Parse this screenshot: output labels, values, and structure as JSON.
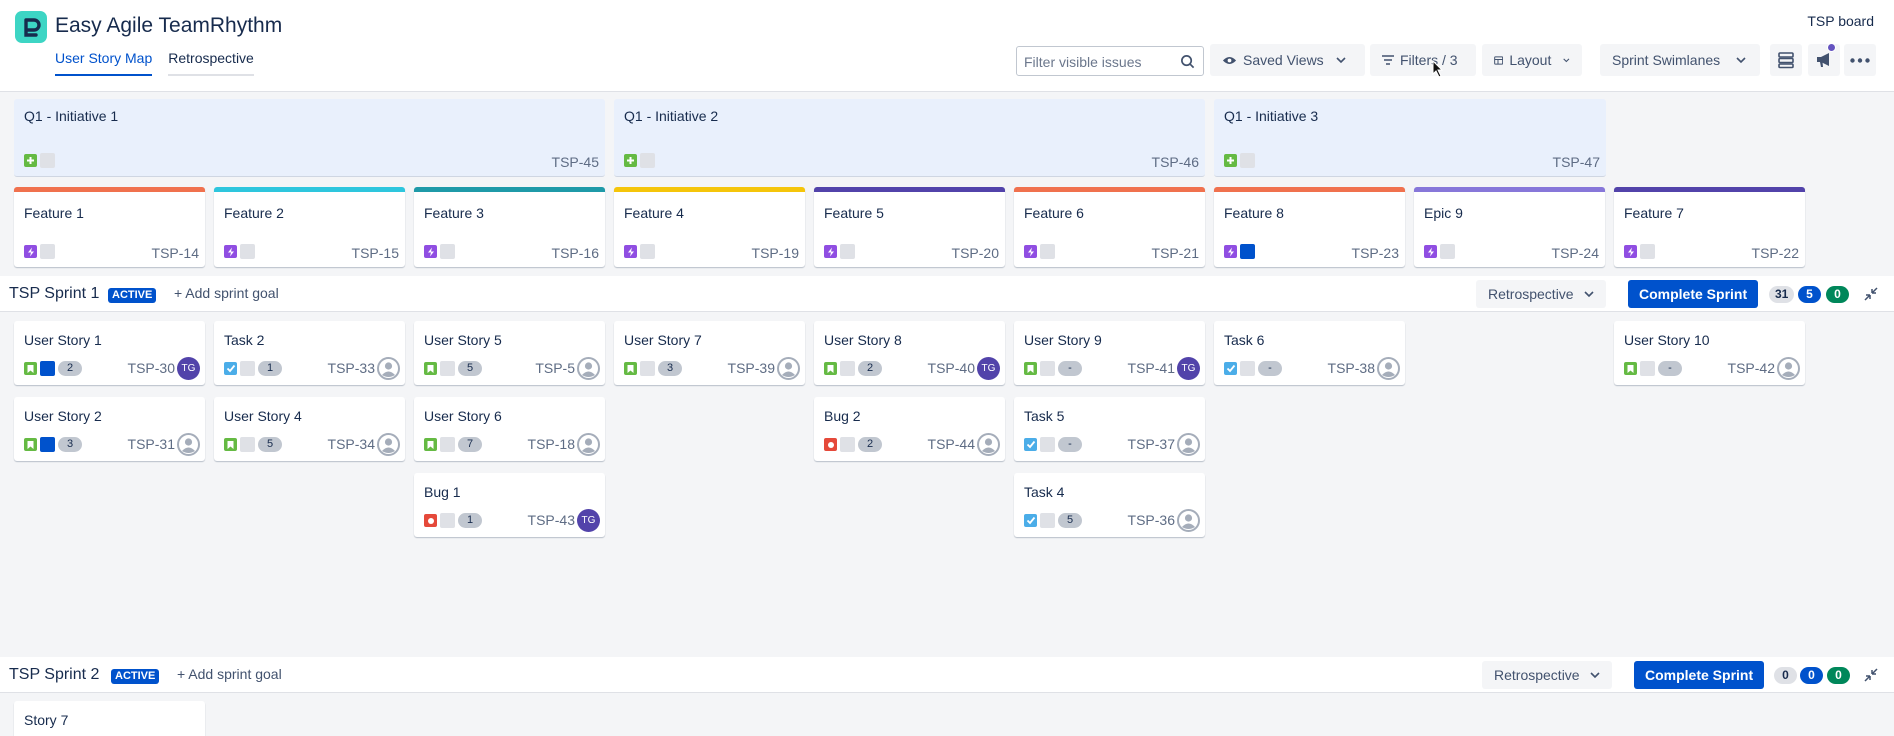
{
  "app": {
    "title": "Easy Agile TeamRhythm",
    "board_name": "TSP board"
  },
  "tabs": [
    {
      "label": "User Story Map"
    },
    {
      "label": "Retrospective"
    }
  ],
  "toolbar": {
    "search_placeholder": "Filter visible issues",
    "saved_views": "Saved Views",
    "filters": "Filters / 3",
    "layout": "Layout",
    "swimlanes": "Sprint Swimlanes"
  },
  "colors": {
    "accent": "#0052cc",
    "initiative_bg": "#e9f0fc",
    "story_type": "#65ba43",
    "task_type": "#4bade8",
    "bug_type": "#e5493a",
    "epic_type": "#904ee2"
  },
  "initiatives": [
    {
      "title": "Q1 - Initiative 1",
      "key": "TSP-45"
    },
    {
      "title": "Q1 - Initiative 2",
      "key": "TSP-46"
    },
    {
      "title": "Q1 - Initiative 3",
      "key": "TSP-47"
    }
  ],
  "features": [
    {
      "title": "Feature 1",
      "key": "TSP-14",
      "color": "#f0714e"
    },
    {
      "title": "Feature 2",
      "key": "TSP-15",
      "color": "#2ec6dd"
    },
    {
      "title": "Feature 3",
      "key": "TSP-16",
      "color": "#1f9aa8"
    },
    {
      "title": "Feature 4",
      "key": "TSP-19",
      "color": "#f5c50a"
    },
    {
      "title": "Feature 5",
      "key": "TSP-20",
      "color": "#5243aa"
    },
    {
      "title": "Feature 6",
      "key": "TSP-21",
      "color": "#f0714e"
    },
    {
      "title": "Feature 8",
      "key": "TSP-23",
      "color": "#f0714e"
    },
    {
      "title": "Epic 9",
      "key": "TSP-24",
      "color": "#8777d9"
    },
    {
      "title": "Feature 7",
      "key": "TSP-22",
      "color": "#5243aa"
    }
  ],
  "sprints": [
    {
      "name": "TSP Sprint 1",
      "status": "ACTIVE",
      "add_goal": "Add sprint goal",
      "retro": "Retrospective",
      "complete": "Complete Sprint",
      "counts": [
        "31",
        "5",
        "0"
      ]
    },
    {
      "name": "TSP Sprint 2",
      "status": "ACTIVE",
      "add_goal": "Add sprint goal",
      "retro": "Retrospective",
      "complete": "Complete Sprint",
      "counts": [
        "0",
        "0",
        "0"
      ]
    }
  ],
  "sprint1_cards": [
    {
      "title": "User Story 1",
      "key": "TSP-30",
      "points": "2",
      "assignee": "TG"
    },
    {
      "title": "User Story 2",
      "key": "TSP-31",
      "points": "3",
      "assignee": ""
    },
    {
      "title": "Task 2",
      "key": "TSP-33",
      "points": "1",
      "assignee": ""
    },
    {
      "title": "User Story 4",
      "key": "TSP-34",
      "points": "5",
      "assignee": ""
    },
    {
      "title": "User Story 5",
      "key": "TSP-5",
      "points": "5",
      "assignee": ""
    },
    {
      "title": "User Story 6",
      "key": "TSP-18",
      "points": "7",
      "assignee": ""
    },
    {
      "title": "Bug 1",
      "key": "TSP-43",
      "points": "1",
      "assignee": "TG"
    },
    {
      "title": "User Story 7",
      "key": "TSP-39",
      "points": "3",
      "assignee": ""
    },
    {
      "title": "User Story 8",
      "key": "TSP-40",
      "points": "2",
      "assignee": "TG"
    },
    {
      "title": "Bug 2",
      "key": "TSP-44",
      "points": "2",
      "assignee": ""
    },
    {
      "title": "User Story 9",
      "key": "TSP-41",
      "points": "-",
      "assignee": "TG"
    },
    {
      "title": "Task 5",
      "key": "TSP-37",
      "points": "-",
      "assignee": ""
    },
    {
      "title": "Task 4",
      "key": "TSP-36",
      "points": "5",
      "assignee": ""
    },
    {
      "title": "Task 6",
      "key": "TSP-38",
      "points": "-",
      "assignee": ""
    },
    {
      "title": "User Story 10",
      "key": "TSP-42",
      "points": "-",
      "assignee": ""
    }
  ],
  "sprint2_cards": [
    {
      "title": "Story 7"
    }
  ]
}
